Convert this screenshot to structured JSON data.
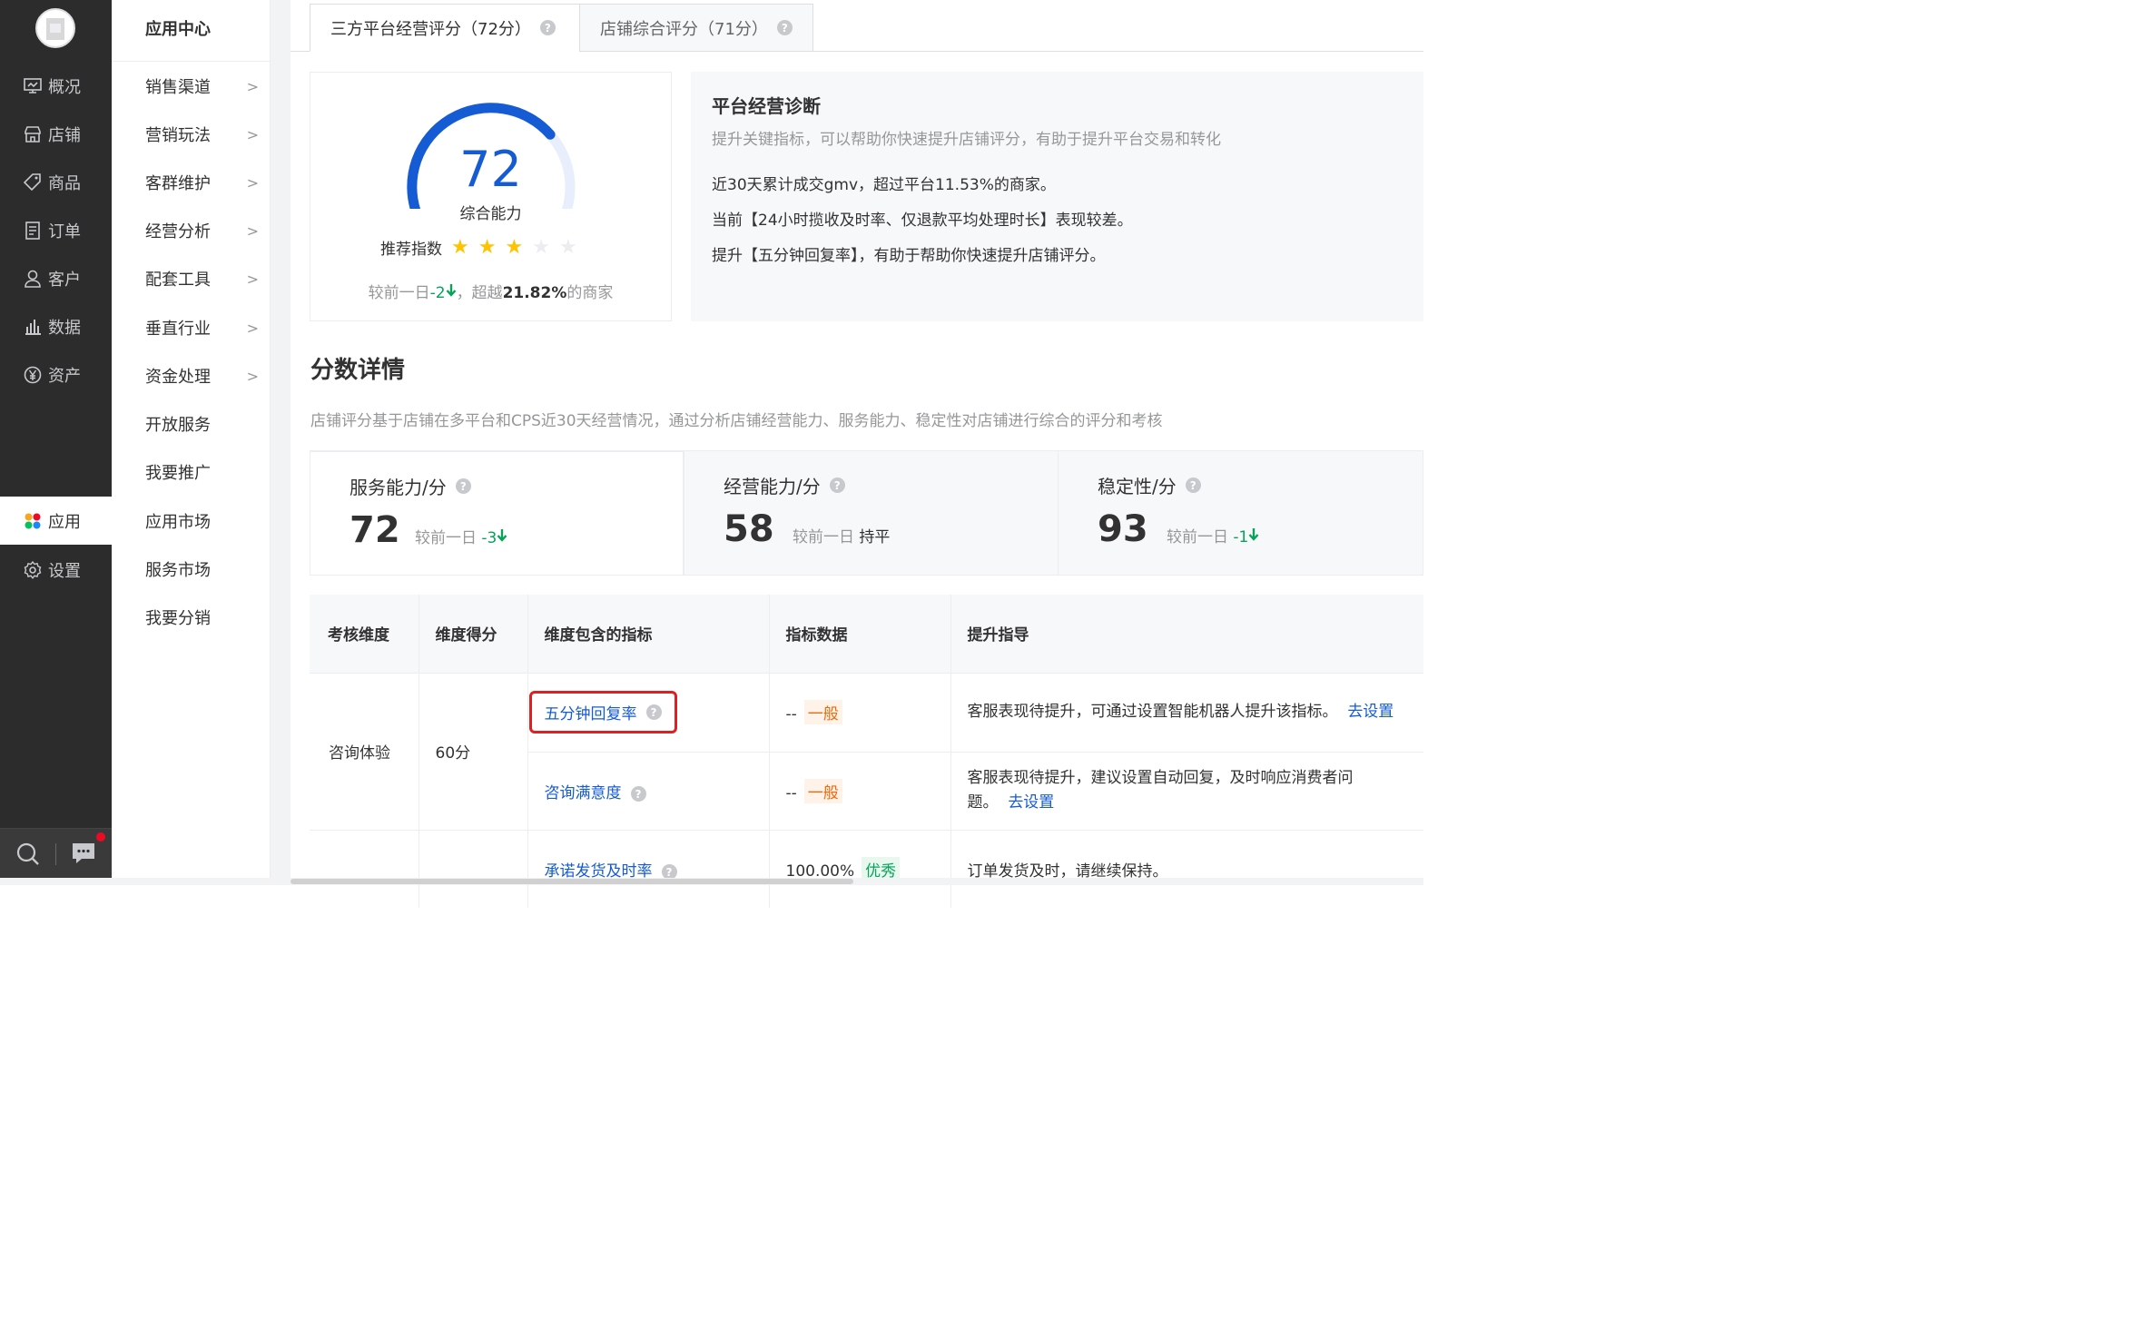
{
  "rail": {
    "items": [
      {
        "label": "概况",
        "icon": "monitor-icon"
      },
      {
        "label": "店铺",
        "icon": "store-icon"
      },
      {
        "label": "商品",
        "icon": "tag-icon"
      },
      {
        "label": "订单",
        "icon": "order-list-icon"
      },
      {
        "label": "客户",
        "icon": "user-icon"
      },
      {
        "label": "数据",
        "icon": "bar-chart-icon"
      },
      {
        "label": "资产",
        "icon": "yen-icon"
      },
      {
        "label": "应用",
        "icon": "apps-icon"
      },
      {
        "label": "设置",
        "icon": "gear-icon"
      }
    ],
    "active": "应用"
  },
  "sidebar": {
    "title": "应用中心",
    "items": [
      {
        "label": "销售渠道",
        "chevron": ">"
      },
      {
        "label": "营销玩法",
        "chevron": ">"
      },
      {
        "label": "客群维护",
        "chevron": ">"
      },
      {
        "label": "经营分析",
        "chevron": ">"
      },
      {
        "label": "配套工具",
        "chevron": ">"
      },
      {
        "label": "垂直行业",
        "chevron": ">"
      },
      {
        "label": "资金处理",
        "chevron": ">"
      },
      {
        "label": "开放服务",
        "chevron": ""
      },
      {
        "label": "我要推广",
        "chevron": ""
      },
      {
        "label": "应用市场",
        "chevron": ""
      },
      {
        "label": "服务市场",
        "chevron": ""
      },
      {
        "label": "我要分销",
        "chevron": ""
      }
    ]
  },
  "tabs": [
    {
      "label": "三方平台经营评分（72分）"
    },
    {
      "label": "店铺综合评分（71分）"
    }
  ],
  "gauge": {
    "score": "72",
    "label": "综合能力",
    "recommend_label": "推荐指数",
    "stars_filled": 3,
    "stars_total": 5,
    "star_color": "#ffc300",
    "compare_prefix": "较前一日",
    "compare_delta": "-2",
    "compare_mid": "，超越",
    "compare_pct": "21.82%",
    "compare_suffix": "的商家"
  },
  "diagnosis": {
    "title": "平台经营诊断",
    "subtitle": "提升关键指标，可以帮助你快速提升店铺评分，有助于提升平台交易和转化",
    "lines": [
      "近30天累计成交gmv，超过平台11.53%的商家。",
      "当前【24小时揽收及时率、仅退款平均处理时长】表现较差。",
      "提升【五分钟回复率】，有助于帮助你快速提升店铺评分。"
    ]
  },
  "details": {
    "title": "分数详情",
    "desc": "店铺评分基于店铺在多平台和CPS近30天经营情况，通过分析店铺经营能力、服务能力、稳定性对店铺进行综合的评分和考核"
  },
  "metrics": [
    {
      "name": "服务能力/分",
      "score": "72",
      "cmp_label": "较前一日",
      "cmp_value": "-3",
      "trend": "down"
    },
    {
      "name": "经营能力/分",
      "score": "58",
      "cmp_label": "较前一日",
      "cmp_value": "持平",
      "trend": "flat"
    },
    {
      "name": "稳定性/分",
      "score": "93",
      "cmp_label": "较前一日",
      "cmp_value": "-1",
      "trend": "down"
    }
  ],
  "table": {
    "headers": [
      "考核维度",
      "维度得分",
      "维度包含的指标",
      "指标数据",
      "提升指导"
    ],
    "dimension": "咨询体验",
    "dimension_score": "60分",
    "rows": [
      {
        "indicator": "五分钟回复率",
        "data": "--",
        "level": "一般",
        "guide": "客服表现待提升，可通过设置智能机器人提升该指标。",
        "link": "去设置"
      },
      {
        "indicator": "咨询满意度",
        "data": "--",
        "level": "一般",
        "guide": "客服表现待提升，建议设置自动回复，及时响应消费者问题。",
        "link": "去设置"
      },
      {
        "indicator": "承诺发货及时率",
        "data": "100.00%",
        "level": "优秀",
        "guide": "订单发货及时，请继续保持。",
        "link": ""
      }
    ]
  },
  "colors": {
    "accent": "#155bd4",
    "down": "#07a35a",
    "highlight_border": "#e02020",
    "warn": "#ed6a0c"
  }
}
